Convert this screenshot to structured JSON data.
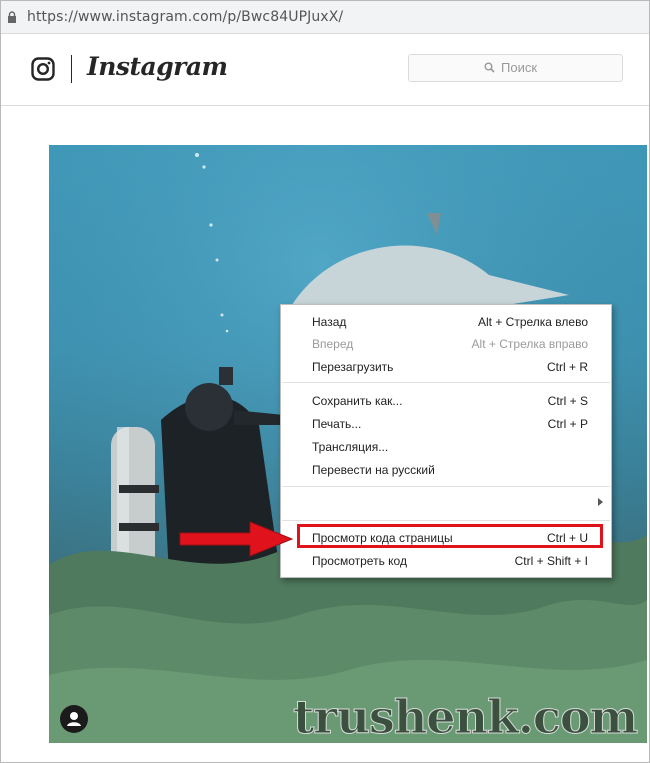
{
  "browser": {
    "url": "https://www.instagram.com/p/Bwc84UPJuxX/"
  },
  "instagram": {
    "logo_text": "Instagram",
    "search_placeholder": "Поиск"
  },
  "context_menu": {
    "items": [
      {
        "label": "Назад",
        "shortcut": "Alt + Стрелка влево",
        "disabled": false
      },
      {
        "label": "Вперед",
        "shortcut": "Alt + Стрелка вправо",
        "disabled": true
      },
      {
        "label": "Перезагрузить",
        "shortcut": "Ctrl + R",
        "disabled": false
      },
      {
        "label": "Сохранить как...",
        "shortcut": "Ctrl + S",
        "disabled": false
      },
      {
        "label": "Печать...",
        "shortcut": "Ctrl + P",
        "disabled": false
      },
      {
        "label": "Трансляция...",
        "shortcut": "",
        "disabled": false
      },
      {
        "label": "Перевести на русский",
        "shortcut": "",
        "disabled": false
      },
      {
        "label": "",
        "shortcut": "",
        "disabled": false
      },
      {
        "label": "Просмотр кода страницы",
        "shortcut": "Ctrl + U",
        "disabled": false
      },
      {
        "label": "Просмотреть код",
        "shortcut": "Ctrl + Shift + I",
        "disabled": false
      }
    ]
  },
  "watermark": "trushenk.com",
  "colors": {
    "highlight": "#e0131c",
    "arrow": "#e0131c"
  }
}
